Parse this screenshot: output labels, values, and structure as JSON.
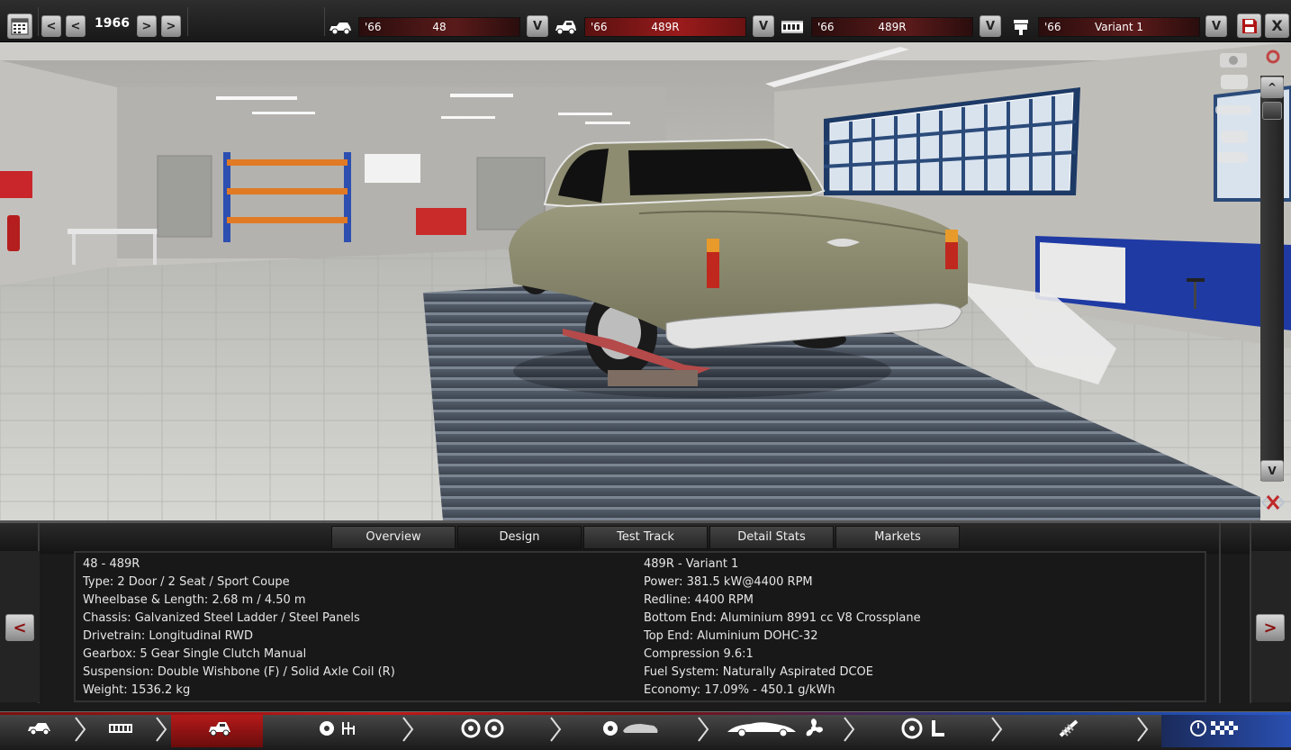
{
  "topbar": {
    "calendar_icon": "calendar-icon",
    "prev_label": "<",
    "next_label": ">",
    "year": "1966",
    "selectors": [
      {
        "icon": "car-body-icon",
        "year": "'66",
        "value": "48",
        "dropdown": "V"
      },
      {
        "icon": "model-icon",
        "year": "'66",
        "value": "489R",
        "dropdown": "V"
      },
      {
        "icon": "engine-block-icon",
        "year": "'66",
        "value": "489R",
        "dropdown": "V"
      },
      {
        "icon": "piston-icon",
        "year": "'66",
        "value": "Variant 1",
        "dropdown": "V"
      }
    ],
    "save_icon": "save-icon",
    "close_label": "X"
  },
  "viewport": {
    "scroll_up": "^",
    "scroll_down": "V"
  },
  "tabs": [
    "Overview",
    "Design",
    "Test Track",
    "Detail Stats",
    "Markets"
  ],
  "active_tab": "Design",
  "info": {
    "left": [
      "48 - 489R",
      "Type: 2 Door / 2 Seat / Sport Coupe",
      "Wheelbase & Length: 2.68 m / 4.50 m",
      "Chassis: Galvanized Steel Ladder / Steel Panels",
      "Drivetrain: Longitudinal RWD",
      "Gearbox: 5 Gear Single Clutch Manual",
      "Suspension: Double Wishbone (F) / Solid Axle Coil (R)",
      "Weight: 1536.2 kg"
    ],
    "right": [
      "489R - Variant 1",
      "Power: 381.5 kW@4400 RPM",
      "Redline: 4400 RPM",
      "Bottom End: Aluminium 8991 cc V8 Crossplane",
      "Top End: Aluminium DOHC-32",
      "Compression 9.6:1",
      "Fuel System: Naturally Aspirated DCOE",
      "Economy: 17.09% - 450.1 g/kWh"
    ],
    "prev_label": "<",
    "next_label": ">"
  },
  "bottom_nav": [
    {
      "icon": "car-body-icon"
    },
    {
      "icon": "chassis-icon"
    },
    {
      "icon": "model-icon",
      "active": true
    },
    {
      "icon": "engine-gearbox-icon"
    },
    {
      "icon": "wheels-icon"
    },
    {
      "icon": "aero-fan-icon"
    },
    {
      "icon": "interior-icon"
    },
    {
      "icon": "suspension-icon"
    },
    {
      "icon": "test-flag-icon"
    }
  ],
  "colors": {
    "accent_red": "#9a1b1b",
    "car_paint": "#8f8e70"
  }
}
